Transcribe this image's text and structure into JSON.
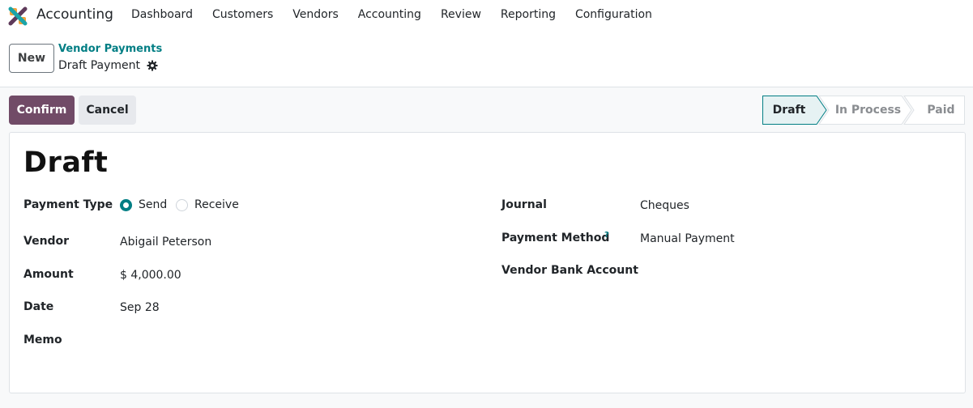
{
  "app": {
    "name": "Accounting",
    "logo_icon": "odoo-accounting-logo-icon",
    "colors": {
      "brand": "#714b67",
      "link": "#017e84"
    }
  },
  "nav": {
    "items": [
      "Dashboard",
      "Customers",
      "Vendors",
      "Accounting",
      "Review",
      "Reporting",
      "Configuration"
    ]
  },
  "control": {
    "new_label": "New",
    "breadcrumb_parent": "Vendor Payments",
    "breadcrumb_current": "Draft Payment",
    "settings_icon": "gear-icon"
  },
  "actions": {
    "confirm_label": "Confirm",
    "cancel_label": "Cancel"
  },
  "statusbar": {
    "stages": [
      "Draft",
      "In Process",
      "Paid"
    ],
    "active": "Draft"
  },
  "form": {
    "title": "Draft",
    "payment_type": {
      "label": "Payment Type",
      "options": [
        "Send",
        "Receive"
      ],
      "selected": "Send"
    },
    "vendor": {
      "label": "Vendor",
      "value": "Abigail Peterson"
    },
    "amount": {
      "label": "Amount",
      "value": "$ 4,000.00"
    },
    "date": {
      "label": "Date",
      "value": "Sep 28"
    },
    "memo": {
      "label": "Memo",
      "value": ""
    },
    "journal": {
      "label": "Journal",
      "value": "Cheques"
    },
    "payment_method": {
      "label": "Payment Method",
      "help": "?",
      "value": "Manual Payment"
    },
    "vendor_bank_account": {
      "label": "Vendor Bank Account",
      "value": ""
    }
  }
}
